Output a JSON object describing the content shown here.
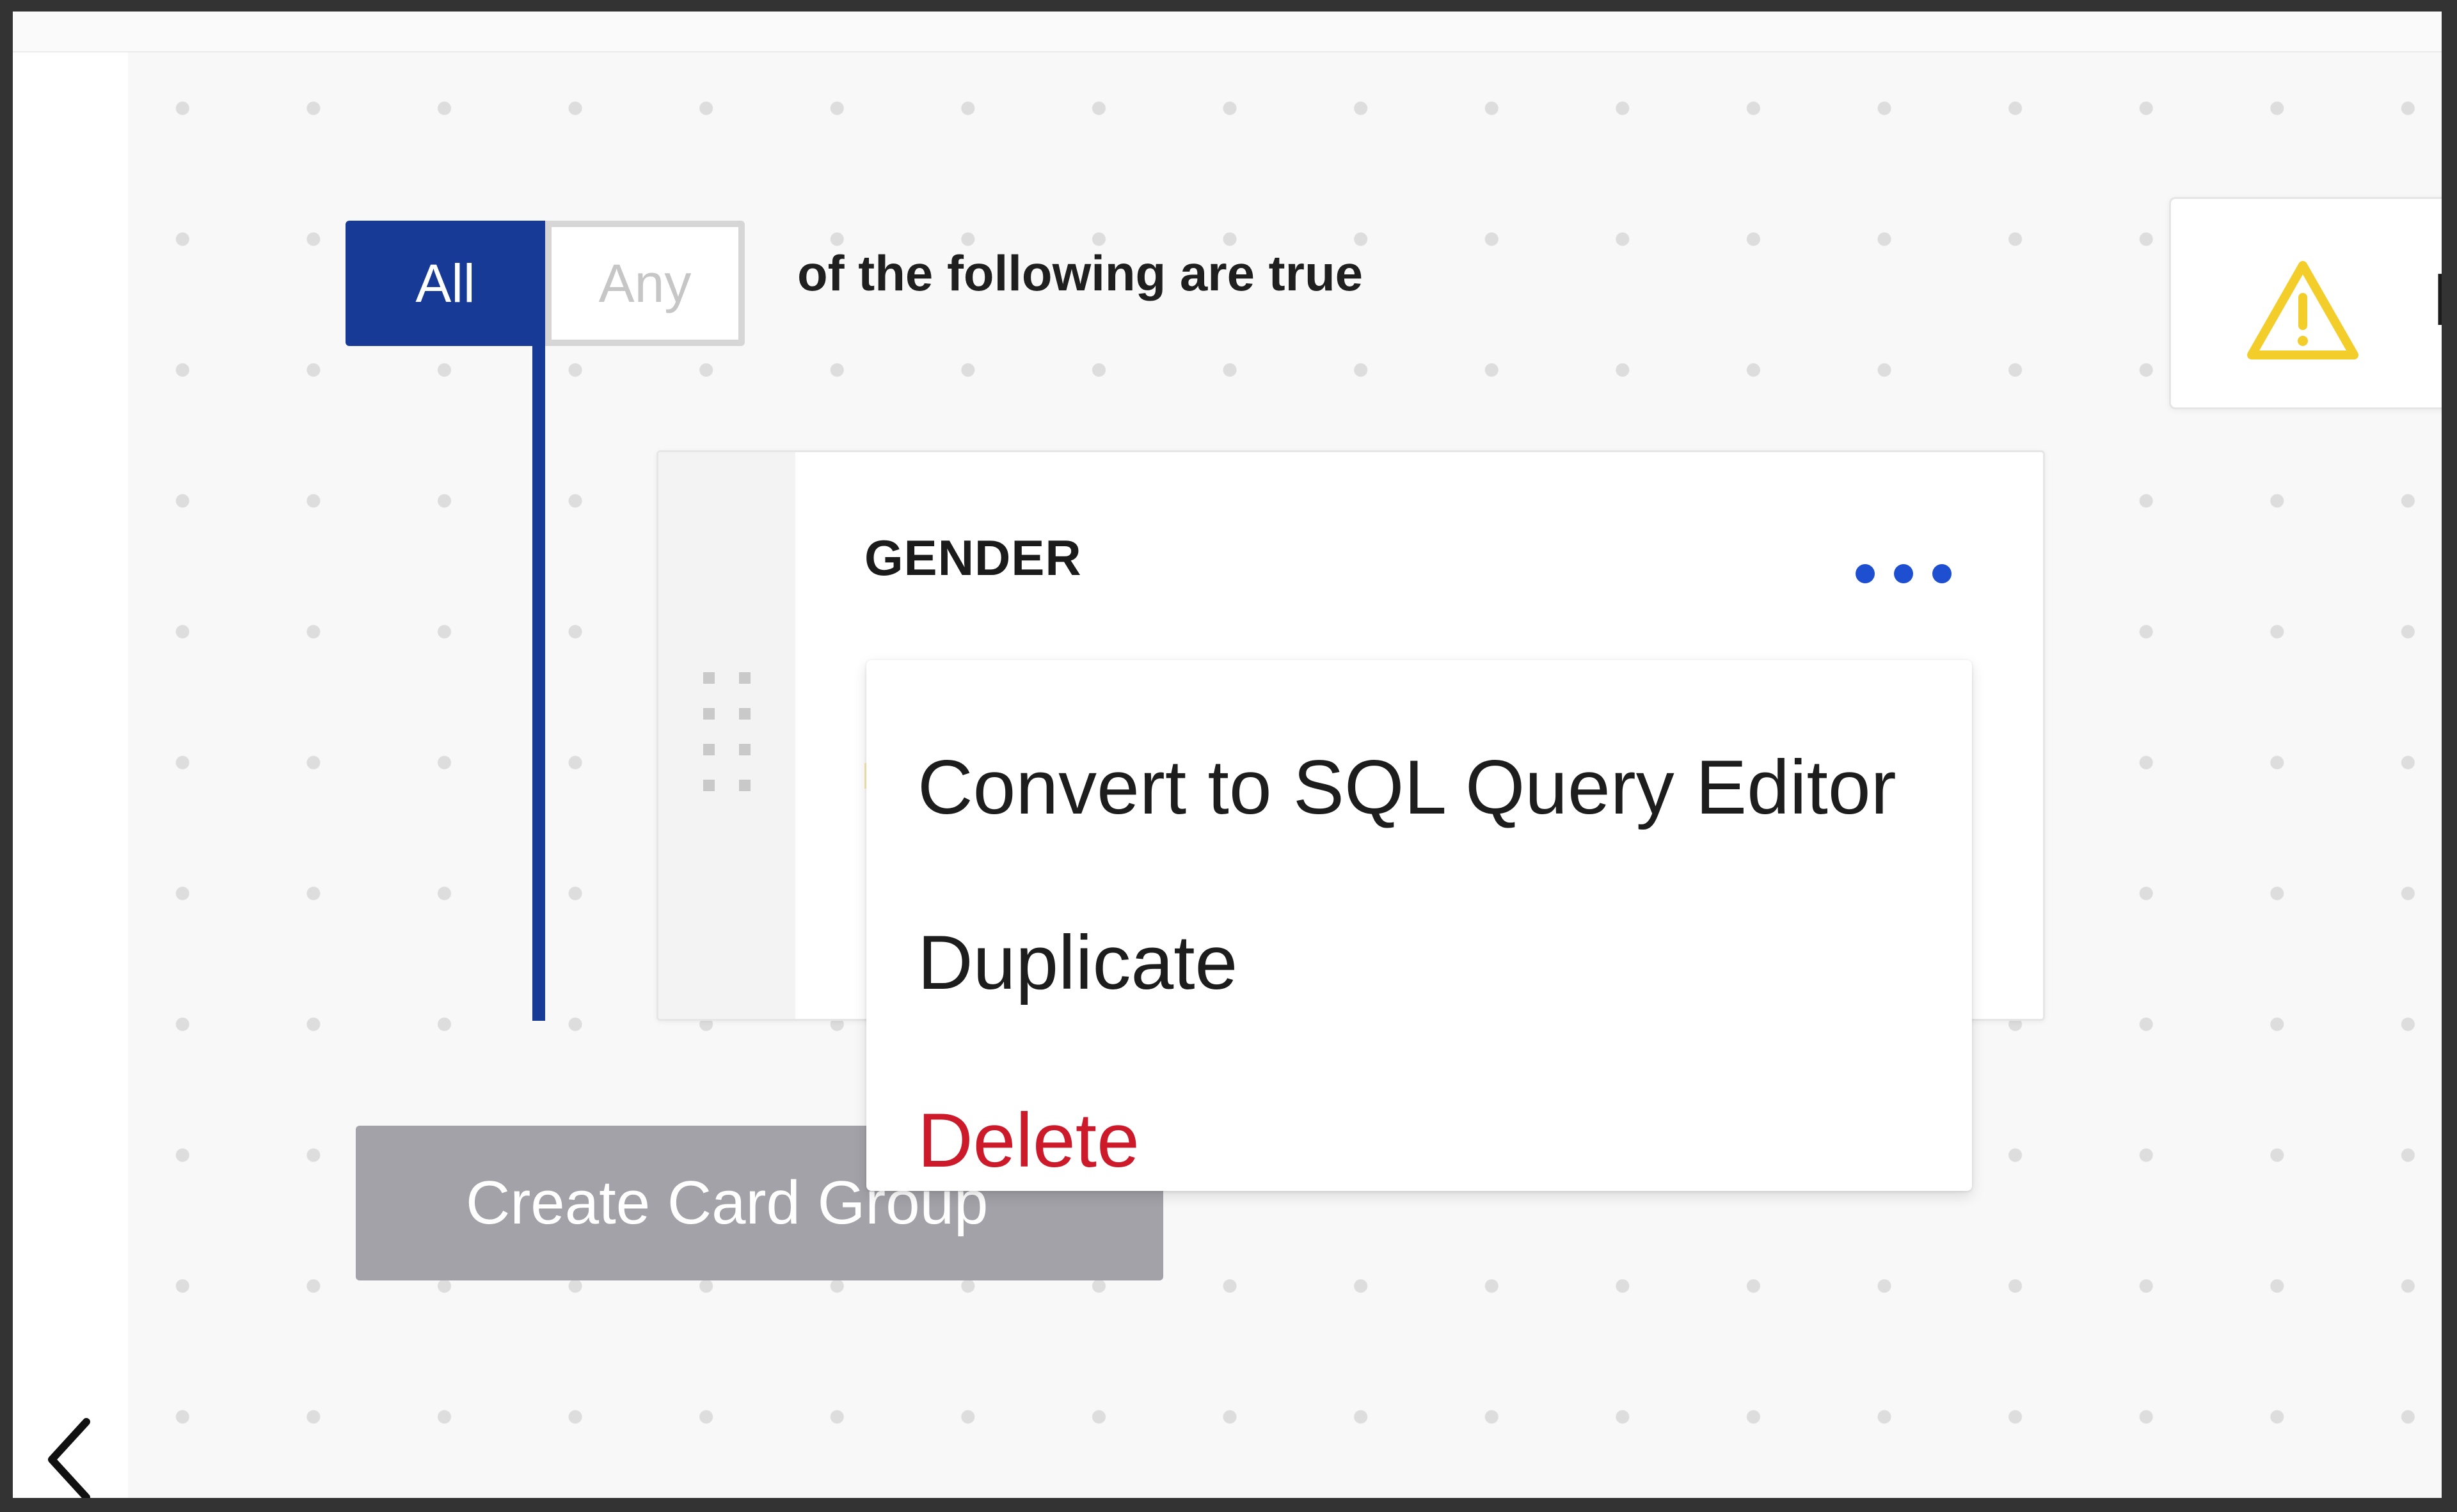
{
  "logic_toggle": {
    "options": [
      "All",
      "Any"
    ],
    "selected": "All",
    "sentence": "of the following are true"
  },
  "estimate": {
    "text": "Esti",
    "icon": "warning-icon"
  },
  "criteria_card": {
    "title": "GENDER",
    "more_icon": "more-horizontal-icon",
    "drag_icon": "drag-handle-icon"
  },
  "dropdown_menu": {
    "items": [
      {
        "label": "Convert to SQL Query Editor"
      },
      {
        "label": "Duplicate"
      },
      {
        "label": "Delete",
        "destructive": true
      }
    ]
  },
  "actions": {
    "create_card_group": "Create Card Group"
  },
  "navigation": {
    "back_icon": "chevron-left-icon"
  },
  "colors": {
    "accent": "#163a96",
    "warning": "#f3cd2a",
    "danger": "#cc1a2b",
    "disabled_button": "#a2a2a8"
  }
}
